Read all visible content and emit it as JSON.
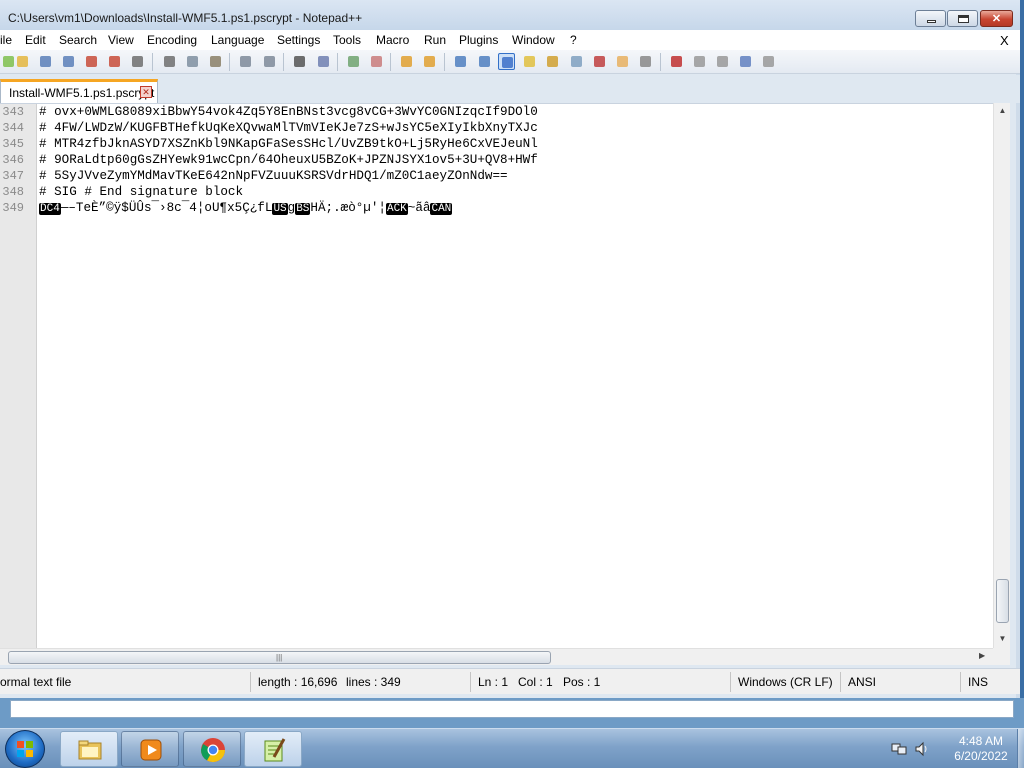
{
  "window": {
    "title": "C:\\Users\\vm1\\Downloads\\Install-WMF5.1.ps1.pscrypt - Notepad++",
    "controls": {
      "minimize": "minimize-button",
      "maximize": "maximize-button",
      "close": "close-button"
    }
  },
  "menu": {
    "items": [
      "ile",
      "Edit",
      "Search",
      "View",
      "Encoding",
      "Language",
      "Settings",
      "Tools",
      "Macro",
      "Run",
      "Plugins",
      "Window",
      "?"
    ],
    "close_doc": "X"
  },
  "toolbar": {
    "icons": [
      "new-file-icon",
      "open-file-icon",
      "save-icon",
      "save-all-icon",
      "close-icon",
      "close-all-icon",
      "print-icon",
      "cut-icon",
      "copy-icon",
      "paste-icon",
      "undo-icon",
      "redo-icon",
      "find-icon",
      "replace-icon",
      "zoom-in-icon",
      "zoom-out-icon",
      "sync-vertical-icon",
      "sync-horizontal-icon",
      "word-wrap-icon",
      "show-all-chars-icon",
      "indent-guide-icon",
      "udl-icon",
      "doc-map-icon",
      "doc-list-icon",
      "function-list-icon",
      "folder-workspace-icon",
      "monitoring-icon",
      "record-macro-icon",
      "stop-macro-icon",
      "play-macro-icon",
      "run-macro-multiple-icon",
      "save-macro-icon"
    ]
  },
  "tab": {
    "label": "Install-WMF5.1.ps1.pscrypt",
    "close": "⊠"
  },
  "editor": {
    "lines": [
      {
        "num": "343",
        "text": "# ovx+0WMLG8089xiBbwY54vok4Zq5Y8EnBNst3vcg8vCG+3WvYC0GNIzqcIf9DOl0"
      },
      {
        "num": "344",
        "text": "# 4FW/LWDzW/KUGFBTHefkUqKeXQvwaMlTVmVIeKJe7zS+wJsYC5eXIyIkbXnyTXJc"
      },
      {
        "num": "345",
        "text": "# MTR4zfbJknASYD7XSZnKbl9NKapGFaSesSHcl/UvZB9tkO+Lj5RyHe6CxVEJeuNl"
      },
      {
        "num": "346",
        "text": "# 9ORaLdtp60gGsZHYewk91wcCpn/64OheuxU5BZoK+JPZNJSYX1ov5+3U+QV8+HWf"
      },
      {
        "num": "347",
        "text": "# 5SyJVveZymYMdMavTKeE642nNpFVZuuuKSRSVdrHDQ1/mZ0C1aeyZOnNdw=="
      },
      {
        "num": "348",
        "text": "# SIG # End signature block"
      },
      {
        "num": "349",
        "segments": [
          {
            "ctl": true,
            "t": "DC4"
          },
          {
            "t": "—–TeÈ”©ÿ$ÜÛs¯›8c¯4¦oU¶x5Ç¿fL"
          },
          {
            "ctl": true,
            "t": "US"
          },
          {
            "t": "g"
          },
          {
            "ctl": true,
            "t": "BS"
          },
          {
            "t": "HÄ;.æò°µ'¦"
          },
          {
            "ctl": true,
            "t": "ACK"
          },
          {
            "t": "~ãâ"
          },
          {
            "ctl": true,
            "t": "CAN"
          }
        ]
      }
    ]
  },
  "status": {
    "type": "ormal text file",
    "length": "length : 16,696",
    "lines": "lines : 349",
    "ln": "Ln : 1",
    "col": "Col : 1",
    "pos": "Pos : 1",
    "eol": "Windows (CR LF)",
    "encoding": "ANSI",
    "mode": "INS"
  },
  "taskbar": {
    "items": [
      "file-explorer-icon",
      "media-player-icon",
      "chrome-icon",
      "notepad-plus-plus-icon"
    ],
    "time": "4:48 AM",
    "date": "6/20/2022"
  },
  "colors": {
    "title_gradient_top": "#dbe6f3",
    "tab_accent": "#f6a623",
    "taskbar": "#7fa2c9"
  }
}
